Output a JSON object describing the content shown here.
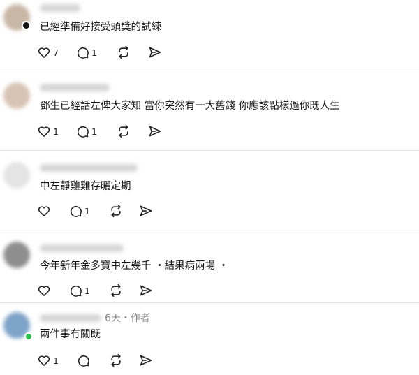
{
  "comments": [
    {
      "text": "已經準備好接受頭獎的試練",
      "likes": "7",
      "replies": "1",
      "avatar_color": "#c9b7a6"
    },
    {
      "text": "鄧生已經話左俾大家知 當你突然有一大舊錢 你應該點樣過你既人生",
      "likes": "1",
      "replies": "1",
      "avatar_color": "#d8c4b5"
    },
    {
      "text": "中左靜雞雞存曬定期",
      "likes": "",
      "replies": "1",
      "avatar_color": "#e4e4e4"
    },
    {
      "text": "今年新年金多寶中左幾千 ・結果病兩場 ・",
      "likes": "",
      "replies": "1",
      "avatar_color": "#8e8e8e"
    },
    {
      "text": "兩件事冇關既",
      "likes": "1",
      "replies": "",
      "avatar_color": "#7fa4c9",
      "meta": "6天・作者",
      "online_color": "#2fc44b"
    }
  ],
  "icons": {
    "like": "heart-icon",
    "reply": "comment-icon",
    "repost": "repost-icon",
    "share": "send-icon"
  }
}
